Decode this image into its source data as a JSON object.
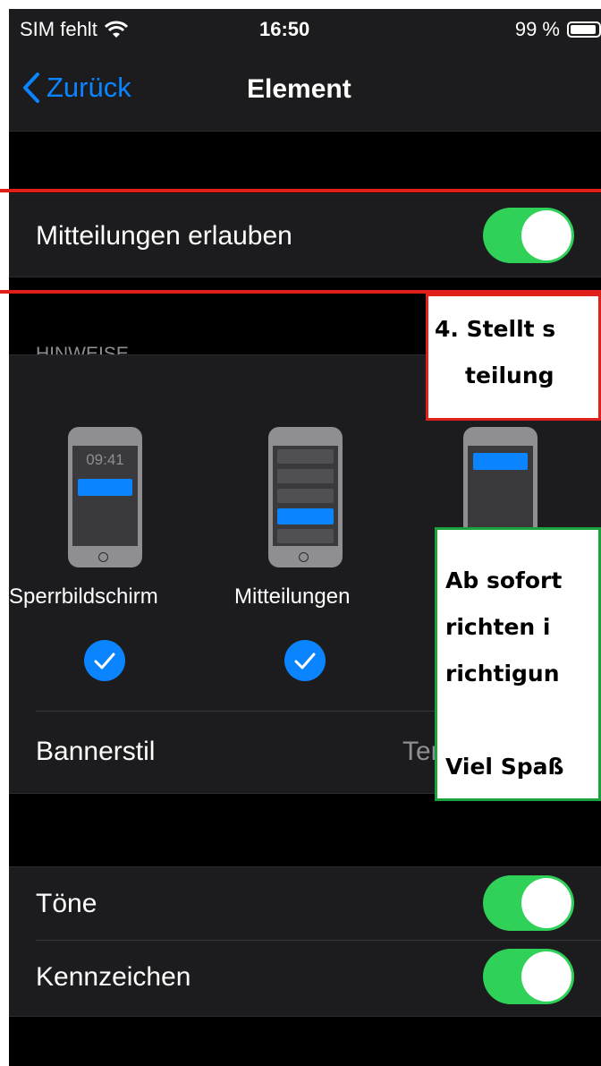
{
  "status": {
    "carrier": "SIM fehlt",
    "time": "16:50",
    "battery": "99 %"
  },
  "nav": {
    "back_label": "Zurück",
    "title": "Element"
  },
  "allow": {
    "label": "Mitteilungen erlauben",
    "on": true
  },
  "hints": {
    "header": "HINWEISE",
    "lock_time": "09:41",
    "lock_label": "Sperrbildschirm",
    "center_label": "Mitteilungen"
  },
  "banner": {
    "label": "Bannerstil",
    "value": "Ter"
  },
  "sounds": {
    "label": "Töne",
    "on": true
  },
  "badges": {
    "label": "Kennzeichen",
    "on": true
  },
  "annotations": {
    "step4_line1": "4. Stellt s",
    "step4_line2": "teilung",
    "note_line1": "Ab sofort",
    "note_line2": "richten i",
    "note_line3": "richtigun",
    "note_line4": "Viel Spaß"
  },
  "colors": {
    "accent": "#0a84ff",
    "toggle_on": "#30d158",
    "annotation_red": "#e0201b",
    "annotation_green": "#1aa33c"
  }
}
